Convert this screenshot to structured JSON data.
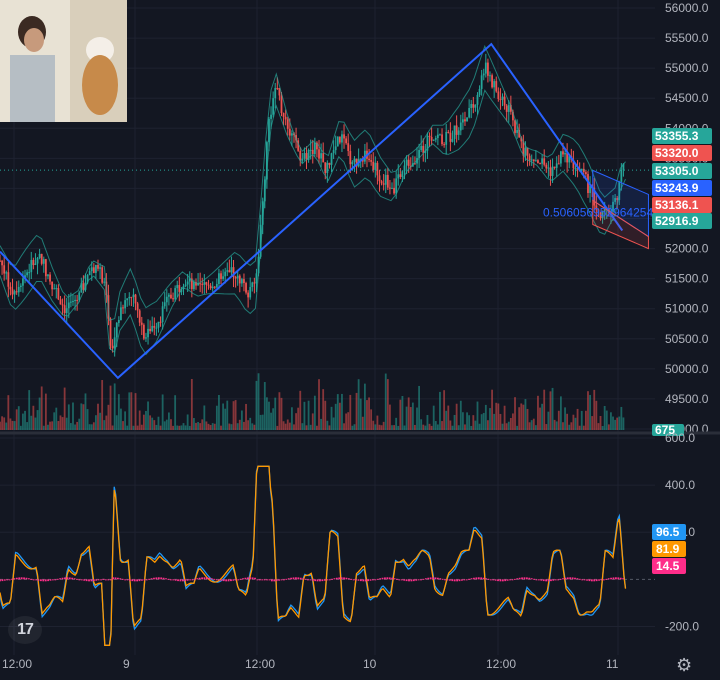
{
  "chart_data": [
    {
      "type": "line",
      "symbol_context": "price candlesticks with envelope bands and drawn trend lines",
      "x_ticks": [
        "12:00",
        "9",
        "12:00",
        "10",
        "12:00",
        "11"
      ],
      "y_ticks": [
        "56000.0",
        "55500.0",
        "55000.0",
        "54500.0",
        "54000.0",
        "53500.0",
        "53000.0",
        "52500.0",
        "52000.0",
        "51500.0",
        "51000.0",
        "50500.0",
        "50000.0",
        "49500.0",
        "49000.0"
      ],
      "ylim": [
        49000,
        56000
      ],
      "price_path": [
        [
          0,
          51800
        ],
        [
          0.02,
          51300
        ],
        [
          0.04,
          51600
        ],
        [
          0.06,
          51900
        ],
        [
          0.08,
          51400
        ],
        [
          0.1,
          51000
        ],
        [
          0.12,
          51200
        ],
        [
          0.14,
          51700
        ],
        [
          0.16,
          51500
        ],
        [
          0.17,
          50200
        ],
        [
          0.18,
          50900
        ],
        [
          0.2,
          51300
        ],
        [
          0.22,
          50600
        ],
        [
          0.24,
          50800
        ],
        [
          0.26,
          51200
        ],
        [
          0.28,
          51500
        ],
        [
          0.3,
          51300
        ],
        [
          0.32,
          51400
        ],
        [
          0.34,
          51500
        ],
        [
          0.36,
          51600
        ],
        [
          0.38,
          51300
        ],
        [
          0.39,
          51400
        ],
        [
          0.4,
          52600
        ],
        [
          0.41,
          54100
        ],
        [
          0.42,
          54700
        ],
        [
          0.44,
          54000
        ],
        [
          0.46,
          53500
        ],
        [
          0.48,
          53700
        ],
        [
          0.5,
          53300
        ],
        [
          0.52,
          53900
        ],
        [
          0.54,
          53400
        ],
        [
          0.56,
          53600
        ],
        [
          0.58,
          53200
        ],
        [
          0.6,
          53000
        ],
        [
          0.62,
          53400
        ],
        [
          0.64,
          53600
        ],
        [
          0.66,
          53900
        ],
        [
          0.68,
          53800
        ],
        [
          0.7,
          54000
        ],
        [
          0.72,
          54300
        ],
        [
          0.74,
          55000
        ],
        [
          0.76,
          54600
        ],
        [
          0.78,
          54200
        ],
        [
          0.8,
          53600
        ],
        [
          0.82,
          53500
        ],
        [
          0.84,
          53300
        ],
        [
          0.86,
          53600
        ],
        [
          0.88,
          53400
        ],
        [
          0.9,
          53000
        ],
        [
          0.92,
          52500
        ],
        [
          0.94,
          52800
        ],
        [
          0.95,
          53300
        ]
      ],
      "trend_lines": [
        {
          "points": [
            [
              0,
              51950
            ],
            [
              0.18,
              49850
            ],
            [
              0.75,
              55400
            ],
            [
              0.95,
              52300
            ]
          ]
        }
      ],
      "channel_annotation": "0.506056952964254",
      "price_labels": [
        {
          "value": "53355.3",
          "color": "#26a69a"
        },
        {
          "value": "53320.0",
          "color": "#ef5350"
        },
        {
          "value": "53305.0",
          "color": "#26a69a"
        },
        {
          "value": "53243.9",
          "color": "#2962ff"
        },
        {
          "value": "53136.1",
          "color": "#ef5350"
        },
        {
          "value": "52916.9",
          "color": "#26a69a"
        }
      ],
      "volume_badge": "675"
    },
    {
      "type": "line",
      "y_ticks": [
        "600.0",
        "400.0",
        "200.0",
        "-200.0"
      ],
      "ylim": [
        -300,
        600
      ],
      "series": [
        {
          "color": "#2196f3",
          "last": "96.5"
        },
        {
          "color": "#ff9800",
          "last": "81.9"
        },
        {
          "color": "#ff2d8a",
          "last": "14.5"
        }
      ]
    }
  ],
  "ui": {
    "logo_text": "17"
  }
}
